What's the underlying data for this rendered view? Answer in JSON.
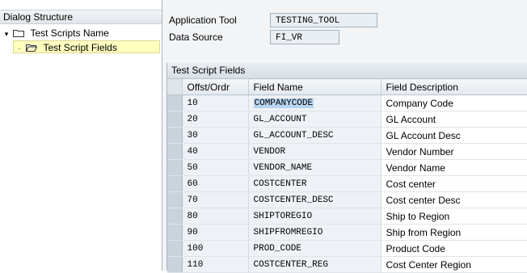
{
  "tree": {
    "header": "Dialog Structure",
    "items": [
      {
        "label": "Test Scripts Name"
      },
      {
        "label": "Test Script Fields"
      }
    ]
  },
  "form": {
    "app_tool_label": "Application Tool",
    "app_tool_value": "TESTING_TOOL",
    "data_source_label": "Data Source",
    "data_source_value": "FI_VR"
  },
  "table": {
    "title": "Test Script Fields",
    "columns": [
      "Offst/Ordr",
      "Field Name",
      "Field Description"
    ],
    "rows": [
      [
        "10",
        "COMPANYCODE",
        "Company Code"
      ],
      [
        "20",
        "GL_ACCOUNT",
        "GL Account"
      ],
      [
        "30",
        "GL_ACCOUNT_DESC",
        "GL Account Desc"
      ],
      [
        "40",
        "VENDOR",
        "Vendor Number"
      ],
      [
        "50",
        "VENDOR_NAME",
        "Vendor Name"
      ],
      [
        "60",
        "COSTCENTER",
        "Cost center"
      ],
      [
        "70",
        "COSTCENTER_DESC",
        "Cost center Desc"
      ],
      [
        "80",
        "SHIPTOREGIO",
        "Ship to Region"
      ],
      [
        "90",
        "SHIPFROMREGIO",
        "Ship from Region"
      ],
      [
        "100",
        "PROD_CODE",
        "Product Code"
      ],
      [
        "110",
        "COSTCENTER_REG",
        "Cost Center Region"
      ]
    ]
  }
}
